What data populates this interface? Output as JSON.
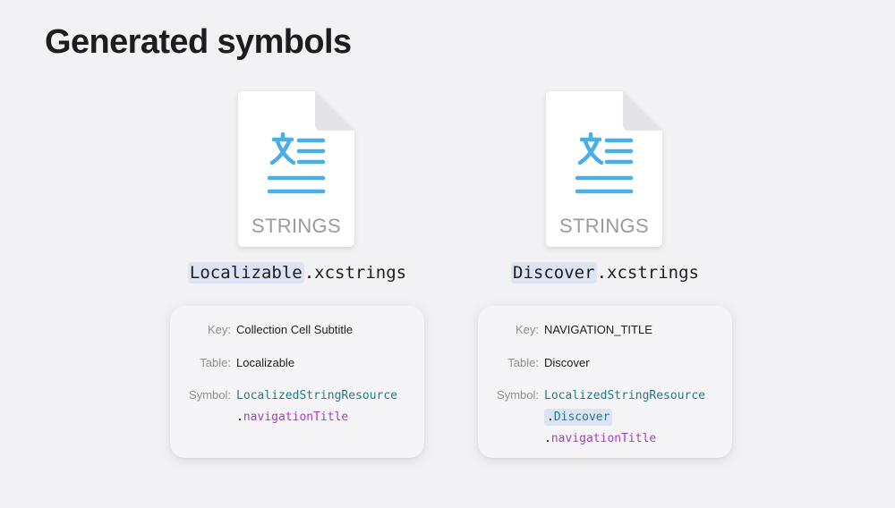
{
  "title": "Generated symbols",
  "colors": {
    "background": "#f2f2f5",
    "icon_blue": "#4aaee8",
    "symbol_type": "#1f7a8c",
    "symbol_property": "#a93cc7",
    "highlight": "#dde3f3"
  },
  "files": [
    {
      "icon": "strings-file-icon",
      "type_label": "STRINGS",
      "name": "Localizable",
      "extension": ".xcstrings",
      "key_label": "Key:",
      "key": "Collection Cell Subtitle",
      "table_label": "Table:",
      "table": "Localizable",
      "symbol_label": "Symbol:",
      "symbol_type": "LocalizedStringResource",
      "symbol_property": "navigationTitle"
    },
    {
      "icon": "strings-file-icon",
      "type_label": "STRINGS",
      "name": "Discover",
      "extension": ".xcstrings",
      "key_label": "Key:",
      "key": "NAVIGATION_TITLE",
      "table_label": "Table:",
      "table": "Discover",
      "symbol_label": "Symbol:",
      "symbol_type": "LocalizedStringResource",
      "symbol_table": "Discover",
      "symbol_property": "navigationTitle"
    }
  ]
}
